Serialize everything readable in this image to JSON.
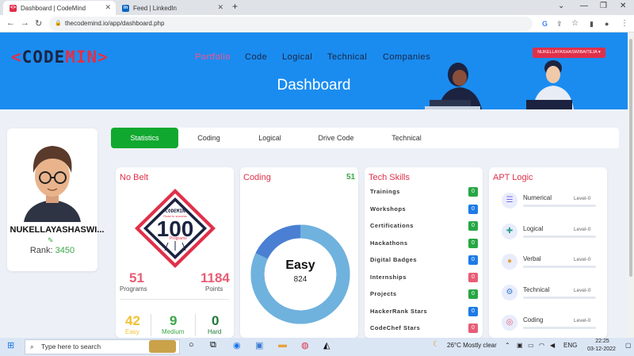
{
  "tabs": [
    {
      "title": "Dashboard | CodeMind"
    },
    {
      "title": "Feed | LinkedIn"
    }
  ],
  "address": {
    "url": "thecodemind.io/app/dashboard.php"
  },
  "header": {
    "logo": {
      "left": "<",
      "code": "CODE",
      "min": "MIN",
      "right": ">"
    },
    "menu": [
      "Portfolio",
      "Code",
      "Logical",
      "Technical",
      "Companies"
    ],
    "user_button": "NUKELLAYASHASWIBAITEJA",
    "title": "Dashboard"
  },
  "profile": {
    "name": "NUKELLAYASHASWI...",
    "rank_label": "Rank:",
    "rank_value": "3450"
  },
  "page_tabs": [
    "Statistics",
    "Coding",
    "Logical",
    "Drive Code",
    "Technical"
  ],
  "no_belt": {
    "title": "No Belt",
    "badge_logo": "<CODEMIN>",
    "badge_sub": "Road to success",
    "badge_value": "100",
    "badge_caption": "Programs",
    "programs": {
      "value": "51",
      "label": "Programs"
    },
    "points": {
      "value": "1184",
      "label": "Points"
    },
    "easy": {
      "value": "42",
      "label": "Easy"
    },
    "medium": {
      "value": "9",
      "label": "Medium"
    },
    "hard": {
      "value": "0",
      "label": "Hard"
    }
  },
  "coding": {
    "title": "Coding",
    "count": "51",
    "donut_label": "Easy",
    "donut_value": "824",
    "donut_fraction": 0.82,
    "colors": {
      "main": "#6fb2de",
      "rest": "#4a7fd4"
    }
  },
  "tech_skills": {
    "title": "Tech Skills",
    "items": [
      {
        "label": "Trainings",
        "value": "0",
        "color": "#28a745"
      },
      {
        "label": "Workshops",
        "value": "0",
        "color": "#1e7be6"
      },
      {
        "label": "Certifications",
        "value": "0",
        "color": "#28a745"
      },
      {
        "label": "Hackathons",
        "value": "0",
        "color": "#28a745"
      },
      {
        "label": "Digital Badges",
        "value": "0",
        "color": "#1e7be6"
      },
      {
        "label": "Internships",
        "value": "0",
        "color": "#e85d75"
      },
      {
        "label": "Projects",
        "value": "0",
        "color": "#28a745"
      },
      {
        "label": "HackerRank Stars",
        "value": "0",
        "color": "#1e7be6"
      },
      {
        "label": "CodeChef Stars",
        "value": "0",
        "color": "#e85d75"
      }
    ]
  },
  "apt": {
    "title": "APT Logic",
    "items": [
      {
        "label": "Numerical",
        "level": "Level-0",
        "icon": "list-icon",
        "glyph": "☰",
        "color": "#7b6be0"
      },
      {
        "label": "Logical",
        "level": "Level-0",
        "icon": "puzzle-icon",
        "glyph": "✚",
        "color": "#2a9d8f"
      },
      {
        "label": "Verbal",
        "level": "Level-0",
        "icon": "chat-icon",
        "glyph": "●",
        "color": "#e6a23c"
      },
      {
        "label": "Technical",
        "level": "Level-0",
        "icon": "gear-icon",
        "glyph": "⚙",
        "color": "#3a7bd5"
      },
      {
        "label": "Coding",
        "level": "Level-0",
        "icon": "code-icon",
        "glyph": "◎",
        "color": "#e85d75"
      }
    ]
  },
  "taskbar": {
    "search_placeholder": "Type here to search",
    "weather": "26°C  Mostly clear",
    "lang": "ENG",
    "time": "22:25",
    "date": "03-12-2022"
  }
}
